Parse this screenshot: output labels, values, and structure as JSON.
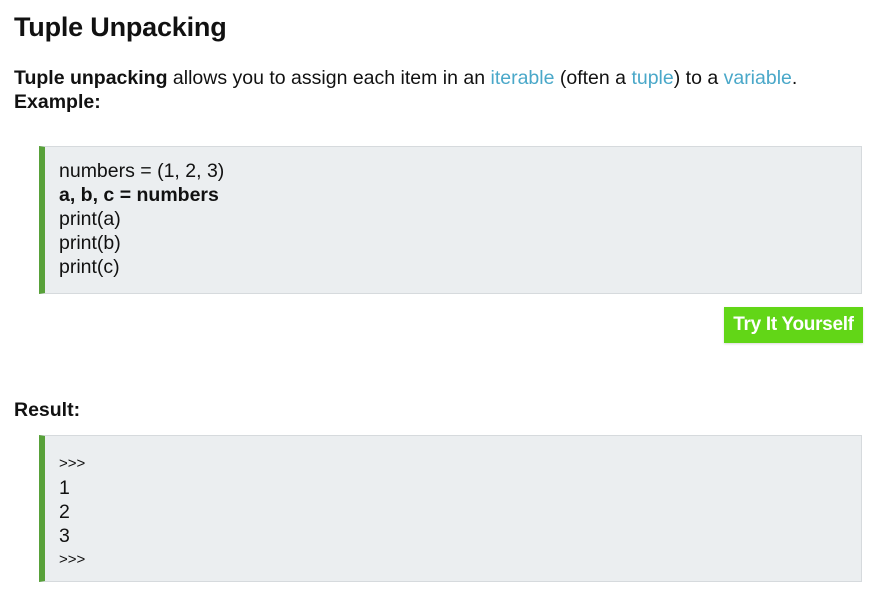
{
  "heading": {
    "title": "Tuple Unpacking"
  },
  "intro": {
    "term": "Tuple unpacking",
    "text1": " allows you to assign each item in an ",
    "link_iterable": "iterable",
    "text2": " (often a ",
    "link_tuple": "tuple",
    "text3": ") to a ",
    "link_variable": "variable",
    "text4": ".",
    "example_label": "Example:"
  },
  "example_code": {
    "lines": [
      "numbers = (1, 2, 3)",
      "a, b, c = numbers",
      "print(a)",
      "print(b)",
      "print(c)"
    ]
  },
  "try_button": {
    "label": "Try It Yourself"
  },
  "result": {
    "label": "Result:",
    "lines": [
      ">>>",
      "1",
      "2",
      "3",
      ">>>"
    ]
  },
  "colors": {
    "link": "#4aa8c9",
    "code_background": "#ebeef0",
    "code_border_accent": "#58a13a",
    "button_background": "#62d617",
    "button_text": "#ffffff"
  }
}
